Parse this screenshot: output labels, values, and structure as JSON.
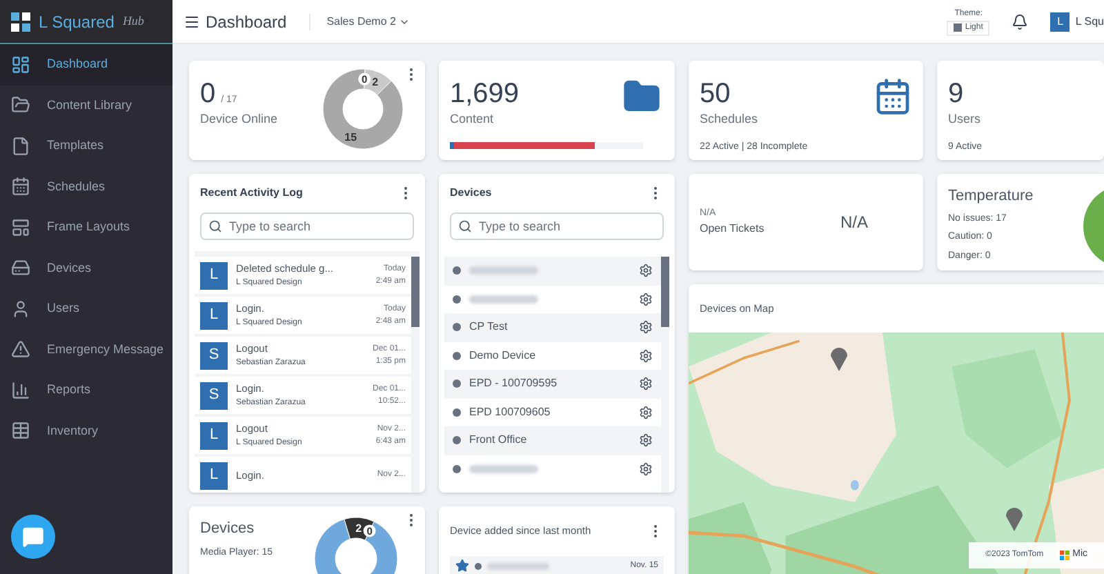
{
  "brand": {
    "name": "L Squared",
    "sub": "Hub"
  },
  "header": {
    "title": "Dashboard",
    "workspace": "Sales Demo 2",
    "theme_label": "Theme:",
    "theme_value": "Light",
    "user_initial": "L",
    "user_name": "L Squ"
  },
  "sidebar": {
    "items": [
      {
        "label": "Dashboard",
        "selected": true
      },
      {
        "label": "Content Library",
        "selected": false
      },
      {
        "label": "Templates",
        "selected": false
      },
      {
        "label": "Schedules",
        "selected": false
      },
      {
        "label": "Frame Layouts",
        "selected": false
      },
      {
        "label": "Devices",
        "selected": false
      },
      {
        "label": "Users",
        "selected": false
      },
      {
        "label": "Emergency Message",
        "selected": false
      },
      {
        "label": "Reports",
        "selected": false
      },
      {
        "label": "Inventory",
        "selected": false
      }
    ]
  },
  "device_online": {
    "value": "0",
    "total": "/ 17",
    "label": "Device Online",
    "chart_data": {
      "type": "donut",
      "values": [
        2,
        15
      ],
      "colors": [
        "#c9c9c9",
        "#a8a8a8"
      ],
      "data_labels": true,
      "annotations": [
        {
          "text": "0"
        }
      ]
    }
  },
  "content": {
    "value": "1,699",
    "label": "Content",
    "segments": [
      {
        "color": "#2f6fb0",
        "level": 0.02
      },
      {
        "color": "#d9434f",
        "level": 0.73
      }
    ]
  },
  "schedules": {
    "value": "50",
    "label": "Schedules",
    "detail": "22 Active | 28 Incomplete"
  },
  "users": {
    "value": "9",
    "label": "Users",
    "detail": "9 Active"
  },
  "tickets": {
    "value": "N/A",
    "label": "Open Tickets",
    "big": "N/A"
  },
  "temperature": {
    "title": "Temperature",
    "lines": [
      "No issues: 17",
      "Caution: 0",
      "Danger: 0"
    ]
  },
  "activity_log": {
    "title": "Recent Activity Log",
    "placeholder": "Type to search",
    "entries": [
      {
        "initial": "L",
        "action": "Deleted schedule g...",
        "user": "L Squared Design",
        "date": "Today",
        "time": "2:49 am"
      },
      {
        "initial": "L",
        "action": "Login.",
        "user": "L Squared Design",
        "date": "Today",
        "time": "2:48 am"
      },
      {
        "initial": "S",
        "action": "Logout",
        "user": "Sebastian Zarazua",
        "date": "Dec 01...",
        "time": "1:35 pm"
      },
      {
        "initial": "S",
        "action": "Login.",
        "user": "Sebastian Zarazua",
        "date": "Dec 01...",
        "time": "10:52..."
      },
      {
        "initial": "L",
        "action": "Logout",
        "user": "L Squared Design",
        "date": "Nov 2...",
        "time": "6:43 am"
      },
      {
        "initial": "L",
        "action": "Login.",
        "date": "Nov 2..."
      }
    ]
  },
  "devices": {
    "title": "Devices",
    "placeholder": "Type to search",
    "items": [
      {
        "kind": "redacted"
      },
      {
        "kind": "redacted"
      },
      {
        "kind": "named",
        "name": "CP Test"
      },
      {
        "kind": "named",
        "name": "Demo Device"
      },
      {
        "kind": "named",
        "name": "EPD - 100709595"
      },
      {
        "kind": "named",
        "name": "EPD 100709605"
      },
      {
        "kind": "named",
        "name": "Front Office"
      },
      {
        "kind": "redacted"
      }
    ]
  },
  "devices_chart": {
    "title": "Devices",
    "legend": "Media Player: 15",
    "chart_data": {
      "type": "donut",
      "values": [
        15,
        2
      ],
      "colors": [
        "#6fa8dc",
        "#333333"
      ],
      "value_labels": [
        null,
        "2"
      ],
      "annotations": [
        {
          "text": "0"
        }
      ]
    }
  },
  "device_added": {
    "title": "Device added since last month",
    "rows": [
      {
        "starred": true,
        "date": "Nov. 15"
      }
    ]
  },
  "map": {
    "title": "Devices on Map",
    "attribution": "©2023 TomTom",
    "partner": "Mic"
  }
}
